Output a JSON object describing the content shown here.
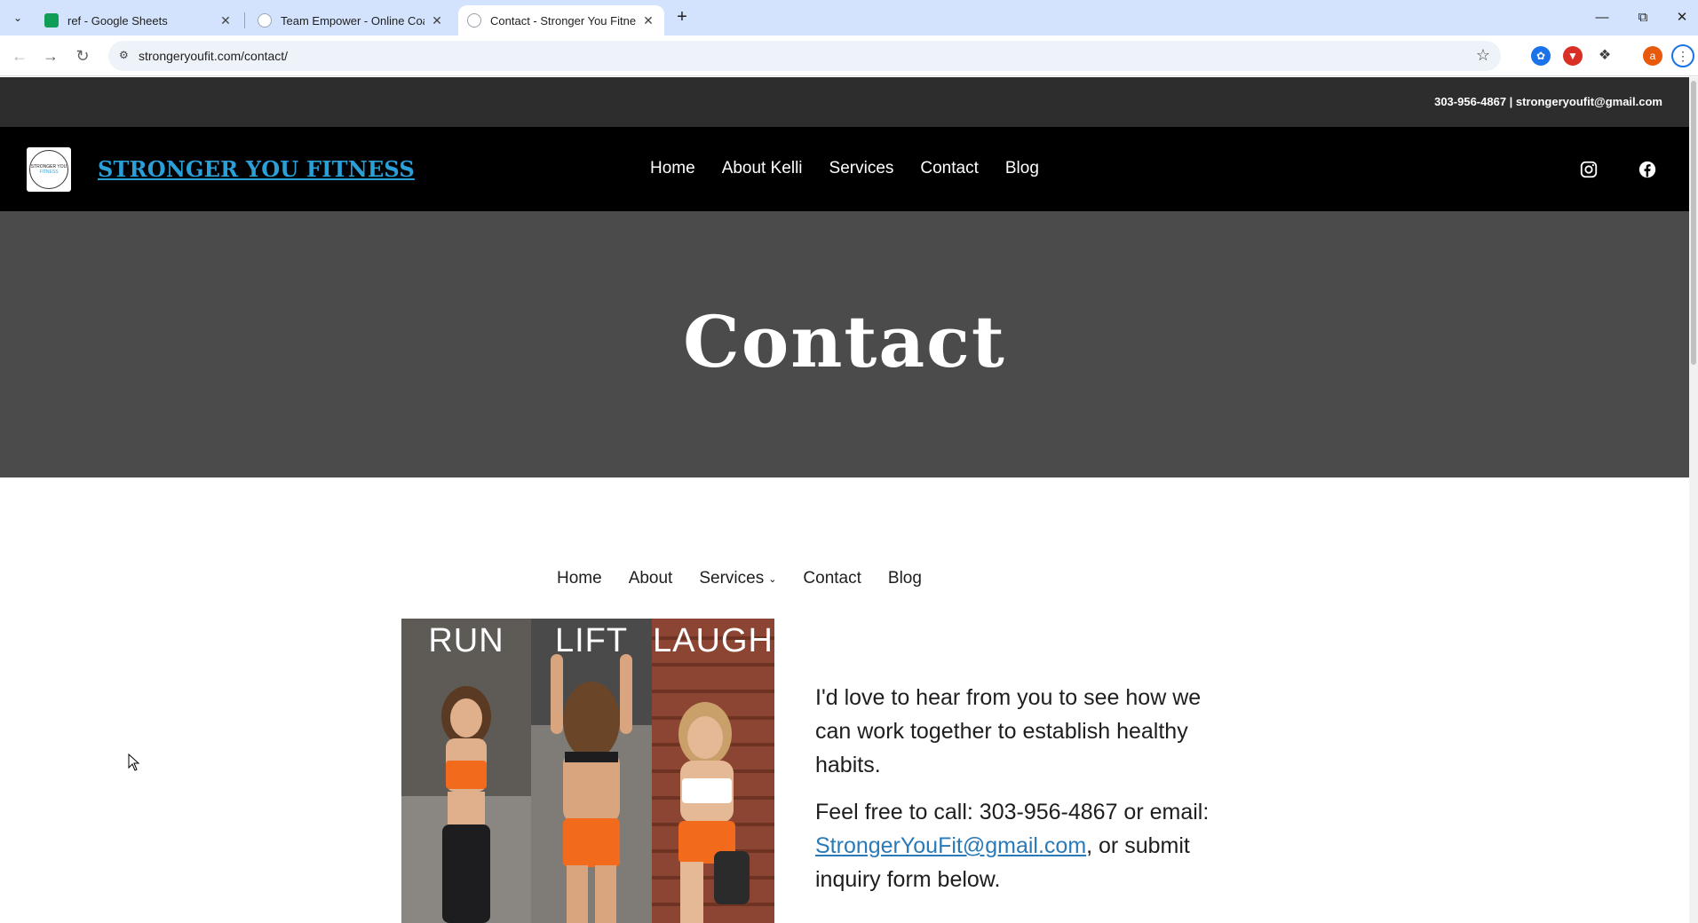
{
  "browser": {
    "tabs": [
      {
        "title": "ref - Google Sheets",
        "favicon": "google-sheets-icon",
        "active": false
      },
      {
        "title": "Team Empower - Online Coachi",
        "favicon": "team-empower-icon",
        "active": false
      },
      {
        "title": "Contact - Stronger You Fitness",
        "favicon": "site-globe-icon",
        "active": true
      }
    ],
    "url": "strongeryoufit.com/contact/",
    "profile_initial": "a"
  },
  "topbar": {
    "contact_line": "303-956-4867 | strongeryoufit@gmail.com"
  },
  "header": {
    "logo": {
      "line1": "STRONGER YOU",
      "line2": "FITNESS"
    },
    "site_name": "STRONGER YOU FITNESS",
    "nav": [
      {
        "label": "Home"
      },
      {
        "label": "About Kelli"
      },
      {
        "label": "Services"
      },
      {
        "label": "Contact"
      },
      {
        "label": "Blog"
      }
    ],
    "social": [
      "instagram-icon",
      "facebook-icon"
    ]
  },
  "hero": {
    "title": "Contact"
  },
  "subnav": {
    "items": [
      {
        "label": "Home"
      },
      {
        "label": "About"
      },
      {
        "label": "Services"
      },
      {
        "label": "Contact"
      },
      {
        "label": "Blog"
      }
    ]
  },
  "photo": {
    "words": [
      "RUN",
      "LIFT",
      "LAUGH"
    ]
  },
  "intro": {
    "p1": "I'd love to hear from you to see how we can work together to establish healthy habits.",
    "p2_prefix": "Feel free to call: 303-956-4867 or email: ",
    "email": "StrongerYouFit@gmail.com",
    "p2_suffix": ", or submit inquiry form below."
  },
  "colors": {
    "chrome_tabbar": "#d3e3fd",
    "topbar": "#2d2d2d",
    "header": "#000000",
    "hero": "#4b4b4b",
    "brand_link": "#2a9fd8"
  }
}
